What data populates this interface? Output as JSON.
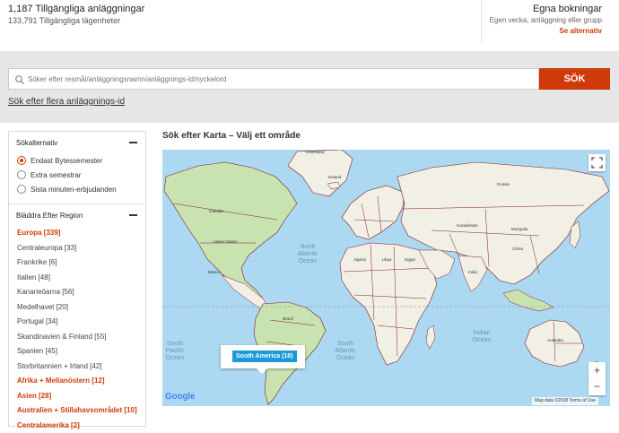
{
  "header": {
    "listings_count": "1,187 Tillgängliga anläggningar",
    "apartments_count": "133,791 Tillgängliga lägenheter",
    "own_bookings": {
      "title": "Egna bokningar",
      "subtitle": "Egen vecka, anläggning eller grupp",
      "link": "Se alternativ"
    }
  },
  "search": {
    "placeholder": "Söker efter resmål/anläggningsnamn/anläggnings-id/nyckelord",
    "button_label": "SÖK",
    "multi_link": "Sök efter flera anläggnings-id"
  },
  "sidebar": {
    "options_title": "Sökalternativ",
    "options": [
      {
        "label": "Endast Bytessemester",
        "checked": true
      },
      {
        "label": "Extra semestrar",
        "checked": false
      },
      {
        "label": "Sista minuten-erbjudanden",
        "checked": false
      }
    ],
    "regions_title": "Bläddra Efter Region",
    "regions": [
      {
        "label": "Europa [339]",
        "highlight": true
      },
      {
        "label": "Centraleuropa [33]",
        "highlight": false
      },
      {
        "label": "Frankrike [6]",
        "highlight": false
      },
      {
        "label": "Italien [48]",
        "highlight": false
      },
      {
        "label": "Kanarieöarna [56]",
        "highlight": false
      },
      {
        "label": "Medelhavet [20]",
        "highlight": false
      },
      {
        "label": "Portugal [34]",
        "highlight": false
      },
      {
        "label": "Skandinavien & Finland [55]",
        "highlight": false
      },
      {
        "label": "Spanien [45]",
        "highlight": false
      },
      {
        "label": "Storbritannien + Irland [42]",
        "highlight": false
      },
      {
        "label": "Afrika + Mellanöstern [12]",
        "highlight": true
      },
      {
        "label": "Asien [28]",
        "highlight": true
      },
      {
        "label": "Australien + Stillahavsområdet [10]",
        "highlight": true
      },
      {
        "label": "Centralamerika [2]",
        "highlight": true
      }
    ]
  },
  "map": {
    "title": "Sök efter Karta – Välj ett område",
    "popup_label": "South America (18)",
    "zoom_in": "+",
    "zoom_out": "−",
    "logo": "Google",
    "attribution": "Map data ©2018     Terms of Use",
    "ocean_labels": {
      "north_atlantic_1": "North",
      "north_atlantic_2": "Atlantic",
      "north_atlantic_3": "Ocean",
      "south_atlantic_1": "South",
      "south_atlantic_2": "Atlantic",
      "south_atlantic_3": "Ocean",
      "indian_1": "Indian",
      "indian_2": "Ocean",
      "south_pacific_1": "South",
      "south_pacific_2": "Pacific",
      "south_pacific_3": "Ocean"
    },
    "country_labels": {
      "greenland": "Greenland",
      "canada": "Canada",
      "united_states": "United States",
      "mexico": "Mexico",
      "brazil": "Brazil",
      "russia": "Russia",
      "kazakhstan": "Kazakhstan",
      "mongolia": "Mongolia",
      "china": "China",
      "india": "India",
      "algeria": "Algeria",
      "libya": "Libya",
      "egypt": "Egypt",
      "australia": "Australia",
      "iceland": "Iceland"
    },
    "colors": {
      "water": "#acd9f1",
      "land": "#f2efe4",
      "green": "#c8e3b0",
      "border": "#7a1f2b"
    }
  }
}
